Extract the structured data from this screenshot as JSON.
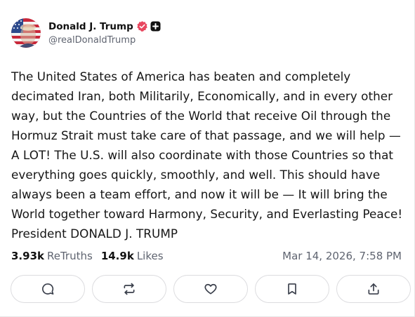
{
  "author": {
    "display_name": "Donald J. Trump",
    "handle": "@realDonaldTrump",
    "avatar_icon": "flag-portrait-avatar",
    "verified_icon": "verified-badge-icon",
    "verified_color": "#e8475f",
    "extra_badge_icon": "plus-badge-icon"
  },
  "post": {
    "text": "The United States of America has beaten and completely\ndecimated Iran, both Militarily, Economically, and in every other\nway, but the Countries of the World that receive Oil through the\nHormuz Strait must take care of that passage, and we will help —\nA LOT! The U.S. will also coordinate with those Countries so that\neverything goes quickly, smoothly, and well. This should have\nalways been a team effort, and now it will be — It will bring the\nWorld together toward Harmony, Security, and Everlasting Peace!\nPresident DONALD J. TRUMP",
    "retruths_count": "3.93k",
    "retruths_label": "ReTruths",
    "likes_count": "14.9k",
    "likes_label": "Likes",
    "timestamp": "Mar 14, 2026, 7:58 PM"
  },
  "actions": [
    {
      "icon": "reply-icon"
    },
    {
      "icon": "retruth-icon"
    },
    {
      "icon": "like-icon"
    },
    {
      "icon": "bookmark-icon"
    },
    {
      "icon": "share-icon"
    }
  ]
}
